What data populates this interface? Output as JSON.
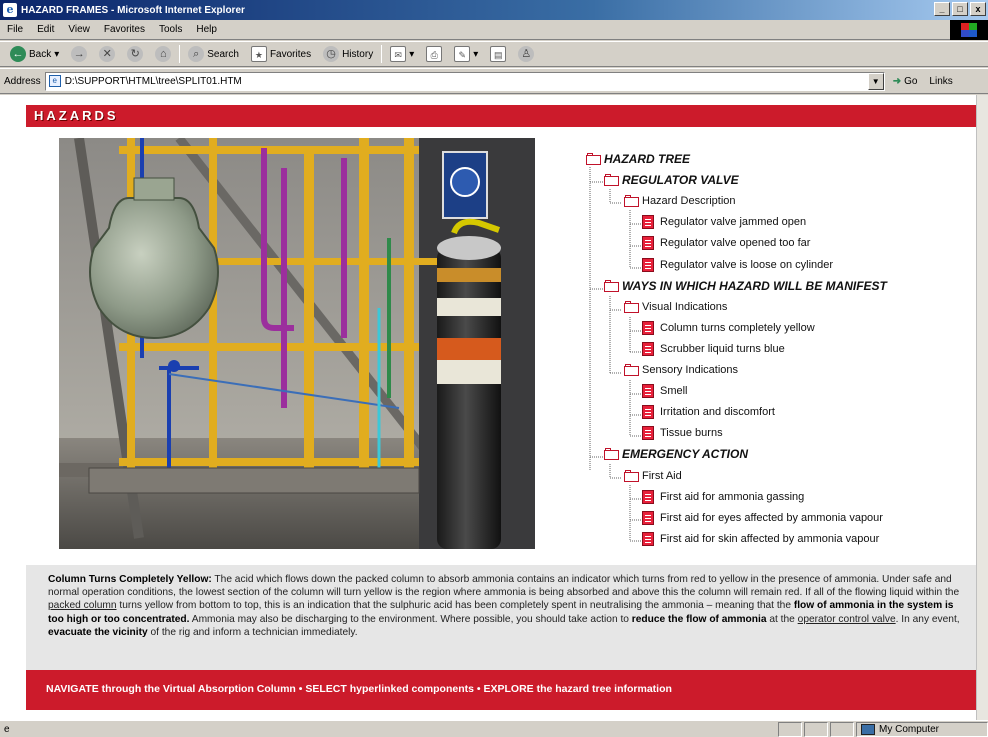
{
  "window": {
    "title": "HAZARD FRAMES - Microsoft Internet Explorer",
    "controls": [
      "_",
      "□",
      "x"
    ]
  },
  "menu": [
    "File",
    "Edit",
    "View",
    "Favorites",
    "Tools",
    "Help"
  ],
  "toolbar": {
    "back": "Back",
    "search": "Search",
    "favorites": "Favorites",
    "history": "History"
  },
  "address": {
    "label": "Address",
    "value": "D:\\SUPPORT\\HTML\\tree\\SPLIT01.HTM",
    "go": "Go",
    "links": "Links"
  },
  "page": {
    "header": "HAZARDS",
    "tree": [
      {
        "label": "HAZARD TREE",
        "level": 0,
        "kind": "folder",
        "bold": true
      },
      {
        "label": "REGULATOR VALVE",
        "level": 1,
        "kind": "folder",
        "bold": true
      },
      {
        "label": "Hazard Description",
        "level": 2,
        "kind": "folder",
        "bold": false
      },
      {
        "label": "Regulator valve jammed open",
        "level": 3,
        "kind": "doc",
        "bold": false
      },
      {
        "label": "Regulator valve opened too far",
        "level": 3,
        "kind": "doc",
        "bold": false
      },
      {
        "label": "Regulator valve is loose on cylinder",
        "level": 3,
        "kind": "doc",
        "bold": false
      },
      {
        "label": "WAYS IN WHICH HAZARD WILL BE MANIFEST",
        "level": 1,
        "kind": "folder",
        "bold": true
      },
      {
        "label": "Visual Indications",
        "level": 2,
        "kind": "folder",
        "bold": false
      },
      {
        "label": "Column turns completely yellow",
        "level": 3,
        "kind": "doc",
        "bold": false
      },
      {
        "label": "Scrubber liquid turns blue",
        "level": 3,
        "kind": "doc",
        "bold": false
      },
      {
        "label": "Sensory Indications",
        "level": 2,
        "kind": "folder",
        "bold": false
      },
      {
        "label": "Smell",
        "level": 3,
        "kind": "doc",
        "bold": false
      },
      {
        "label": "Irritation and discomfort",
        "level": 3,
        "kind": "doc",
        "bold": false
      },
      {
        "label": "Tissue burns",
        "level": 3,
        "kind": "doc",
        "bold": false
      },
      {
        "label": "EMERGENCY ACTION",
        "level": 1,
        "kind": "folder",
        "bold": true
      },
      {
        "label": "First Aid",
        "level": 2,
        "kind": "folder",
        "bold": false
      },
      {
        "label": "First aid for ammonia gassing",
        "level": 3,
        "kind": "doc",
        "bold": false
      },
      {
        "label": "First aid for eyes affected by ammonia vapour",
        "level": 3,
        "kind": "doc",
        "bold": false
      },
      {
        "label": "First aid for skin affected by ammonia vapour",
        "level": 3,
        "kind": "doc",
        "bold": false
      }
    ],
    "description": {
      "heading": "Column Turns Completely Yellow:",
      "t1": " The acid which flows down the packed column to absorb ammonia contains an indicator which turns from red to yellow in the presence of ammonia. Under safe and normal operation conditions, the lowest section of the column will turn yellow is the region where ammonia is being absorbed and above this the column will remain red. If all of the flowing liquid within the ",
      "link1": "packed column",
      "t2": " turns yellow from bottom to top, this is an indication that the sulphuric acid has been completely spent in neutralising the ammonia – meaning that the ",
      "b1": "flow of ammonia in the system is too high or too concentrated.",
      "t3": " Ammonia may also be discharging to the environment. Where possible, you should take action to ",
      "b2": "reduce the flow of ammonia",
      "t4": " at the ",
      "link2": "operator control valve",
      "t5": ". In any event, ",
      "b3": "evacuate the vicinity",
      "t6": " of the rig and inform a technician immediately."
    },
    "nav_text": "NAVIGATE through the Virtual Absorption Column  •  SELECT hyperlinked components  •  EXPLORE the hazard tree information"
  },
  "status": {
    "left": "",
    "zone": "My Computer"
  }
}
